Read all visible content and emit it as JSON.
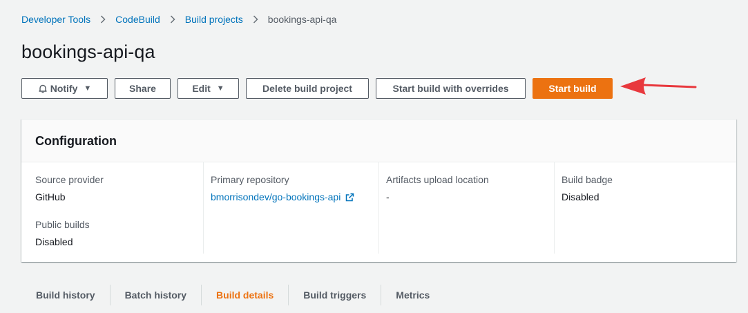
{
  "breadcrumb": {
    "items": [
      "Developer Tools",
      "CodeBuild",
      "Build projects"
    ],
    "current": "bookings-api-qa"
  },
  "page": {
    "title": "bookings-api-qa"
  },
  "actions": {
    "notify": "Notify",
    "share": "Share",
    "edit": "Edit",
    "delete": "Delete build project",
    "start_overrides": "Start build with overrides",
    "start_build": "Start build"
  },
  "configuration": {
    "title": "Configuration",
    "source_provider_label": "Source provider",
    "source_provider_value": "GitHub",
    "public_builds_label": "Public builds",
    "public_builds_value": "Disabled",
    "primary_repo_label": "Primary repository",
    "primary_repo_value": "bmorrisondev/go-bookings-api",
    "artifacts_label": "Artifacts upload location",
    "artifacts_value": "-",
    "badge_label": "Build badge",
    "badge_value": "Disabled"
  },
  "tabs": [
    "Build history",
    "Batch history",
    "Build details",
    "Build triggers",
    "Metrics"
  ],
  "active_tab": "Build details",
  "colors": {
    "accent": "#ec7211",
    "link": "#0073bb",
    "annotation_arrow": "#e8383d"
  },
  "icons": [
    "chevron-right-icon",
    "bell-icon",
    "caret-down-icon",
    "external-link-icon",
    "red-arrow-annotation"
  ]
}
